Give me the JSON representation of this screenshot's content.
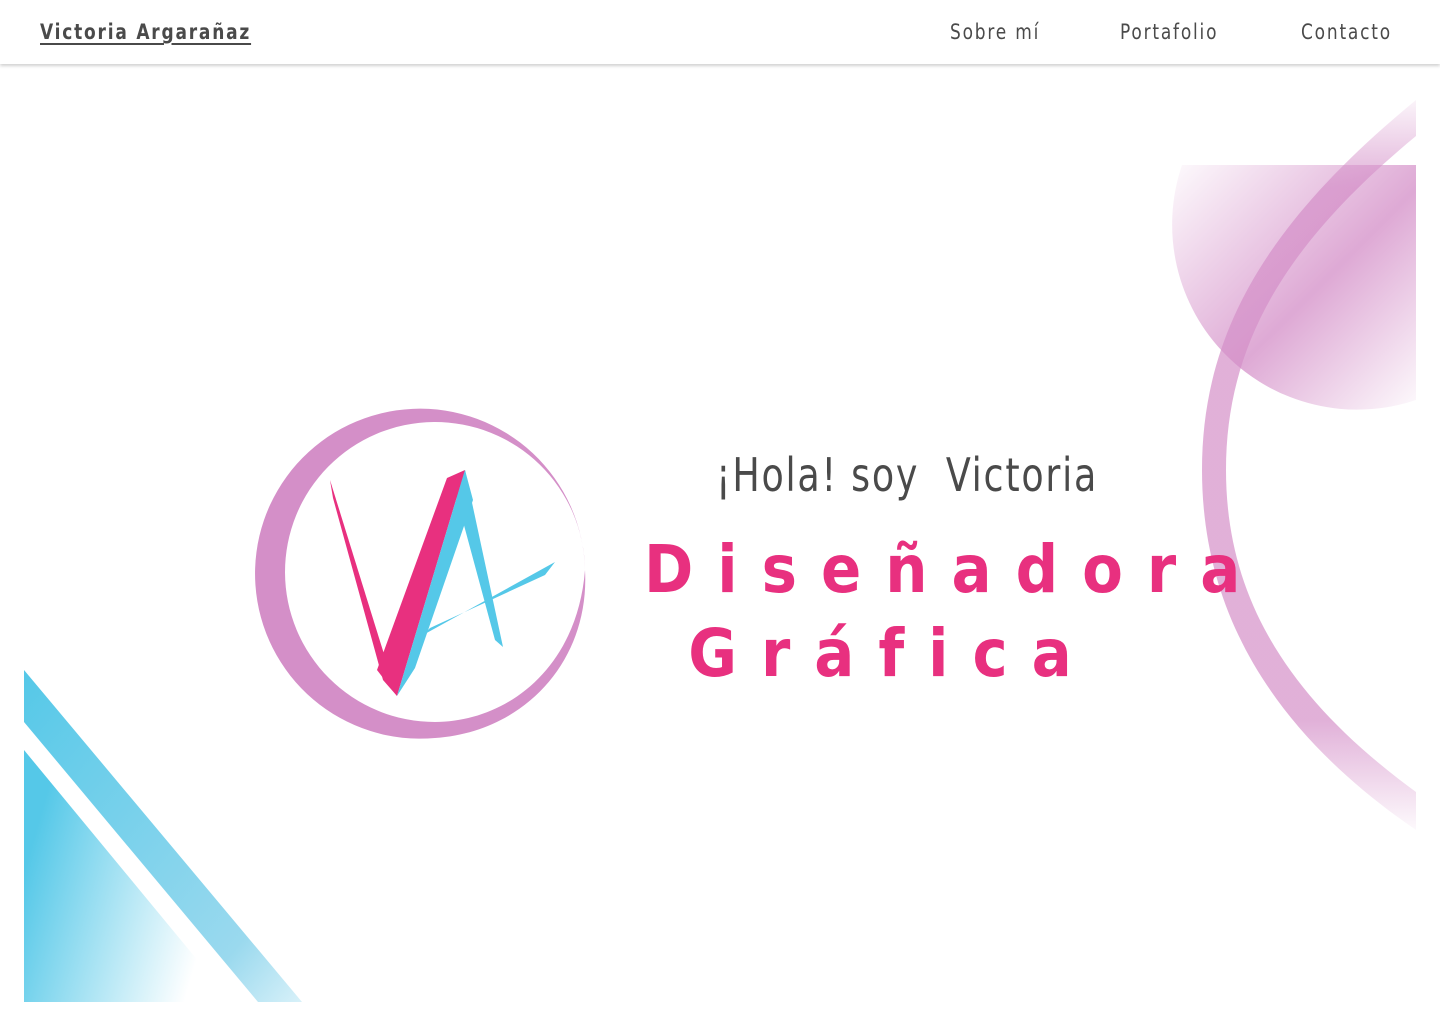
{
  "header": {
    "brand": "Victoria Argarañaz",
    "nav": {
      "about": "Sobre mí",
      "portfolio": "Portafolio",
      "contact": "Contacto"
    }
  },
  "hero": {
    "greeting": "¡Hola! soy  Victoria",
    "title_line1": "Diseñadora",
    "title_line2": "Gráfica"
  },
  "colors": {
    "text_gray": "#4a4a4a",
    "accent_pink": "#e8307f",
    "accent_blue": "#55c8e8",
    "lavender": "#d48fc8"
  },
  "logo": {
    "initials": "VA"
  }
}
